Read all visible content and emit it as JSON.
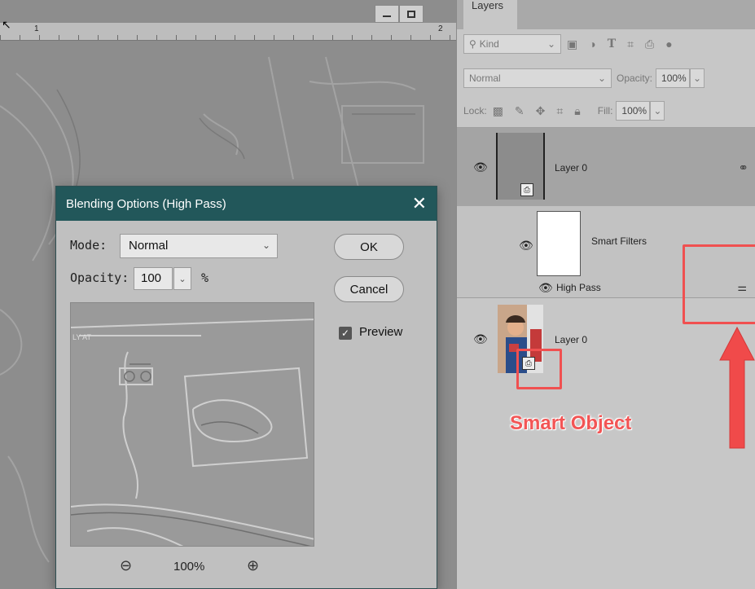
{
  "canvas": {
    "ruler_marks": [
      "1",
      "2"
    ]
  },
  "dialog": {
    "title": "Blending Options (High Pass)",
    "close": "✕",
    "mode_label": "Mode:",
    "mode_value": "Normal",
    "opacity_label": "Opacity:",
    "opacity_value": "100",
    "opacity_unit": "%",
    "ok_label": "OK",
    "cancel_label": "Cancel",
    "preview_label": "Preview",
    "preview_checked": true,
    "zoom_level": "100%"
  },
  "panel": {
    "tab_label": "Layers",
    "filter_kind": "Kind",
    "blend_mode": "Normal",
    "opacity_label": "Opacity:",
    "opacity_value": "100%",
    "lock_label": "Lock:",
    "fill_label": "Fill:",
    "fill_value": "100%",
    "layers": [
      {
        "name": "Layer 0"
      },
      {
        "name": "Smart Filters"
      },
      {
        "name": "High Pass"
      },
      {
        "name": "Layer 0"
      }
    ]
  },
  "annotation": {
    "label": "Smart Object",
    "color": "#f05050"
  }
}
